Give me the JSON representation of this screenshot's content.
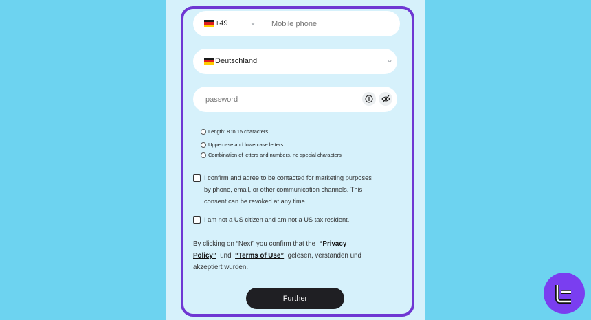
{
  "phone": {
    "flag": "germany-flag",
    "code": "+49",
    "placeholder": "Mobile phone"
  },
  "country": {
    "flag": "germany-flag",
    "value": "Deutschland"
  },
  "password": {
    "placeholder": "password"
  },
  "password_rules": [
    "Length: 8 to 15 characters",
    "Uppercase and lowercase letters",
    "Combination of letters and numbers, no special characters"
  ],
  "consents": {
    "marketing": [
      "I confirm and agree to be contacted for marketing purposes",
      "by phone, email, or other communication channels. This",
      "consent can be revoked at any time."
    ],
    "us_person": "I am not a US citizen and am not a US tax resident."
  },
  "legal": {
    "prefix": "By clicking on “Next” you confirm that the",
    "privacy_link_1": "“Privacy",
    "privacy_link_2": "Policy”",
    "und": "und",
    "terms_link": "“Terms of Use”",
    "suffix_1": "gelesen, verstanden und",
    "suffix_2": "akzeptiert wurden."
  },
  "submit_label": "Further",
  "colors": {
    "background": "#6dd3f0",
    "panel": "#d6f1fb",
    "card_border": "#6f37d3",
    "button": "#1f1f23",
    "badge": "#7a3ef0"
  }
}
